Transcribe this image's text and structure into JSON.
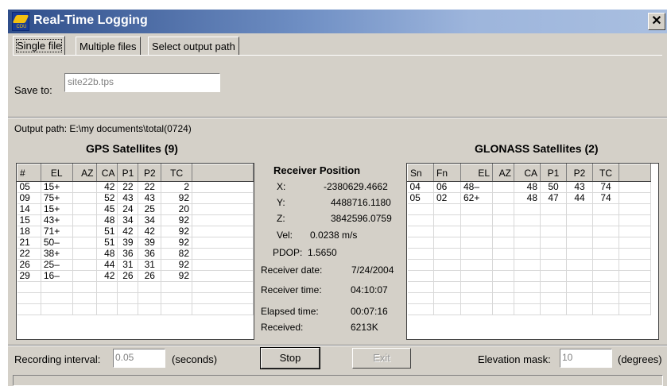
{
  "window": {
    "title": "Real-Time Logging",
    "icon_text": "PC-CDU",
    "close_glyph": "✕"
  },
  "tabs": [
    {
      "label": "Single file"
    },
    {
      "label": "Multiple files"
    },
    {
      "label": "Select output path"
    }
  ],
  "save": {
    "label": "Save to:",
    "value": "site22b.tps"
  },
  "output_path": "Output path:  E:\\my documents\\total(0724)",
  "gps": {
    "title": "GPS Satellites (9)",
    "columns": [
      "#",
      "EL",
      "AZ",
      "CA",
      "P1",
      "P2",
      "TC"
    ],
    "rows": [
      [
        "05",
        "15+",
        "",
        "42",
        "22",
        "22",
        "2"
      ],
      [
        "09",
        "75+",
        "",
        "52",
        "43",
        "43",
        "92"
      ],
      [
        "14",
        "15+",
        "",
        "45",
        "24",
        "25",
        "20"
      ],
      [
        "15",
        "43+",
        "",
        "48",
        "34",
        "34",
        "92"
      ],
      [
        "18",
        "71+",
        "",
        "51",
        "42",
        "42",
        "92"
      ],
      [
        "21",
        "50–",
        "",
        "51",
        "39",
        "39",
        "92"
      ],
      [
        "22",
        "38+",
        "",
        "48",
        "36",
        "36",
        "82"
      ],
      [
        "26",
        "25–",
        "",
        "44",
        "31",
        "31",
        "92"
      ],
      [
        "29",
        "16–",
        "",
        "42",
        "26",
        "26",
        "92"
      ]
    ]
  },
  "glonass": {
    "title": "GLONASS Satellites (2)",
    "columns": [
      "Sn",
      "Fn",
      "EL",
      "AZ",
      "CA",
      "P1",
      "P2",
      "TC"
    ],
    "rows": [
      [
        "04",
        "06",
        "48–",
        "",
        "48",
        "50",
        "43",
        "74"
      ],
      [
        "05",
        "02",
        "62+",
        "",
        "48",
        "47",
        "44",
        "74"
      ]
    ]
  },
  "receiver": {
    "title": "Receiver Position",
    "x_label": "X:",
    "x": "-2380629.4662",
    "y_label": "Y:",
    "y": "4488716.1180",
    "z_label": "Z:",
    "z": "3842596.0759",
    "vel_label": "Vel:",
    "vel": "0.0238 m/s",
    "pdop_label": "PDOP:",
    "pdop": "1.5650",
    "date_label": "Receiver date:",
    "date": "7/24/2004",
    "time_label": "Receiver time:",
    "time": "04:10:07",
    "elapsed_label": "Elapsed time:",
    "elapsed": "00:07:16",
    "received_label": "Received:",
    "received": "6213K"
  },
  "bottom": {
    "interval_label": "Recording interval:",
    "interval_value": "0.05",
    "interval_unit": "(seconds)",
    "stop_label": "Stop",
    "exit_label": "Exit",
    "mask_label": "Elevation mask:",
    "mask_value": "10",
    "mask_unit": "(degrees)"
  }
}
